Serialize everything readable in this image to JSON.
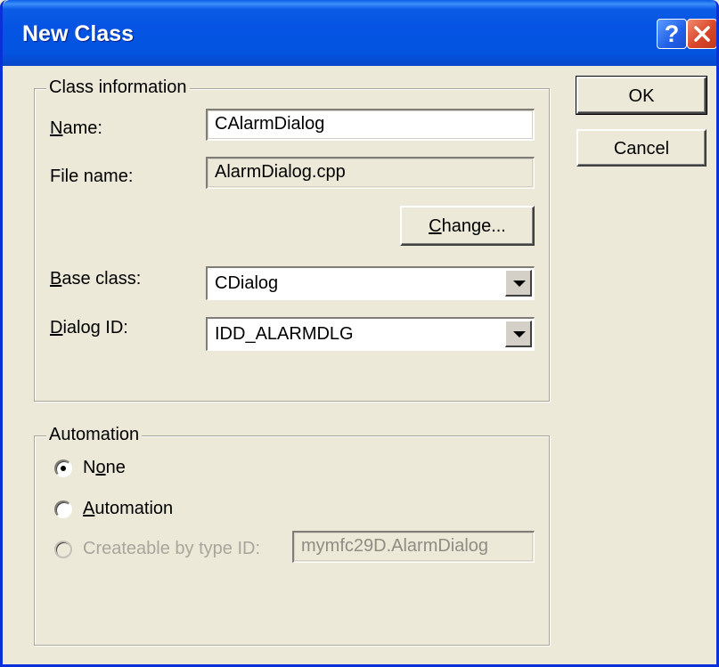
{
  "window": {
    "title": "New Class"
  },
  "titlebar": {
    "help_label": "?"
  },
  "class_info": {
    "legend": "Class information",
    "name_label_hotkey": "N",
    "name_label_rest": "ame:",
    "name_value": "CAlarmDialog",
    "file_label": "File name:",
    "file_value": "AlarmDialog.cpp",
    "change_hotkey": "C",
    "change_rest": "hange...",
    "base_label_hotkey": "B",
    "base_label_rest": "ase class:",
    "base_value": "CDialog",
    "dialog_label_hotkey": "D",
    "dialog_label_rest": "ialog ID:",
    "dialog_value": "IDD_ALARMDLG"
  },
  "automation": {
    "legend": "Automation",
    "none_pre": "N",
    "none_hotkey": "o",
    "none_rest": "ne",
    "auto_hotkey": "A",
    "auto_rest": "utomation",
    "createable_label": "Createable by type ID:",
    "type_id_value": "mymfc29D.AlarmDialog",
    "selected": "None"
  },
  "buttons": {
    "ok": "OK",
    "cancel": "Cancel"
  }
}
